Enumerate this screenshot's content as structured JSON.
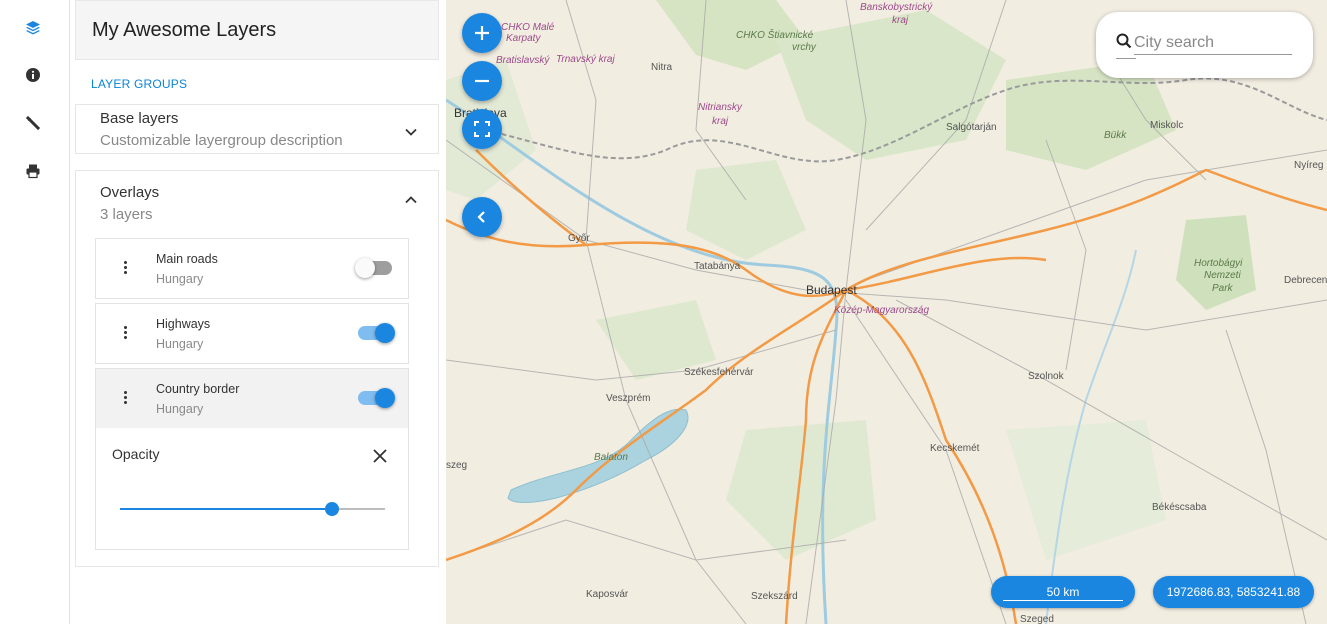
{
  "rail": {
    "items": [
      {
        "icon": "layers-icon",
        "color": "#1a86e0"
      },
      {
        "icon": "info-icon",
        "color": "#333333"
      },
      {
        "icon": "measure-icon",
        "color": "#333333"
      },
      {
        "icon": "print-icon",
        "color": "#333333"
      }
    ]
  },
  "panel": {
    "title": "My Awesome Layers",
    "section_label": "LAYER GROUPS",
    "groups": [
      {
        "title": "Base layers",
        "subtitle": "Customizable layergroup description",
        "expanded": false
      },
      {
        "title": "Overlays",
        "subtitle": "3 layers",
        "expanded": true
      }
    ],
    "layers": [
      {
        "name": "Main roads",
        "subtitle": "Hungary",
        "enabled": false
      },
      {
        "name": "Highways",
        "subtitle": "Hungary",
        "enabled": true
      },
      {
        "name": "Country border",
        "subtitle": "Hungary",
        "enabled": true
      }
    ],
    "opacity": {
      "label": "Opacity",
      "value": 0.8
    }
  },
  "map": {
    "search": {
      "placeholder": "City search"
    },
    "scale": "50 km",
    "coordinates": "1972686.83, 5853241.88",
    "accent": "#1a86e0",
    "labels": {
      "chko_male": "CHKO Malé",
      "karpaty": "Karpaty",
      "bratislavsky": "Bratislavský",
      "trnavsky": "Trnavský kraj",
      "nitra": "Nitra",
      "chko_stiavnicke": "CHKO Štiavnické",
      "vrchy": "vrchy",
      "banskobystricky": "Banskobystrický",
      "kraj1": "kraj",
      "nitriansky": "Nitriansky",
      "kraj2": "kraj",
      "bratislava": "Bratislava",
      "salgotarjan": "Salgótarján",
      "bukk": "Bükk",
      "miskolc": "Miskolc",
      "nyireg": "Nyíreg",
      "gyor": "Győr",
      "tatabanya": "Tatabánya",
      "budapest": "Budapest",
      "kozep": "Közép-Magyarország",
      "hortobagyi": "Hortobágyi",
      "nemzeti": "Nemzeti",
      "park": "Park",
      "debrecen": "Debrecen",
      "szekesfehervar": "Székesfehérvár",
      "veszprem": "Veszprém",
      "szolnok": "Szolnok",
      "balaton": "Balaton",
      "szeg": "szeg",
      "kecskemet": "Kecskemét",
      "bekescsaba": "Békéscsaba",
      "kaposvar": "Kaposvár",
      "szekszard": "Szekszárd",
      "szeged": "Szeged"
    }
  }
}
